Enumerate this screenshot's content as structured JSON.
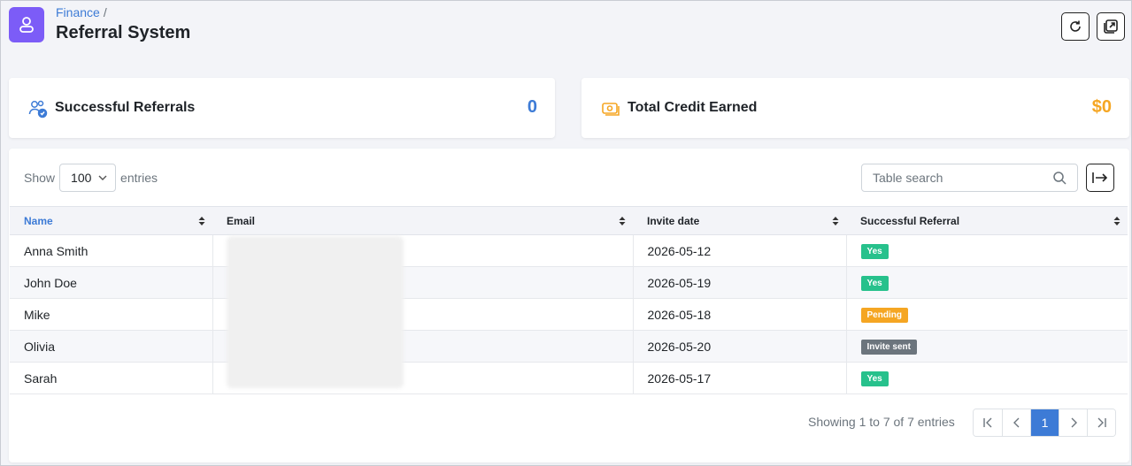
{
  "header": {
    "breadcrumb": "Finance",
    "breadcrumb_sep": "/",
    "title": "Referral System",
    "app_icon": "user-icon",
    "refresh_icon": "refresh-icon",
    "popout_icon": "external-window-icon"
  },
  "cards": {
    "referrals": {
      "label": "Successful Referrals",
      "value": "0",
      "icon": "users-check-icon",
      "color": "#3d7bd6"
    },
    "credit": {
      "label": "Total Credit Earned",
      "value": "$0",
      "icon": "money-icon",
      "color": "#f5a623"
    }
  },
  "table_controls": {
    "show_label": "Show",
    "page_size": "100",
    "entries_label": "entries",
    "search_placeholder": "Table search"
  },
  "table": {
    "columns": [
      "Name",
      "Email",
      "Invite date",
      "Successful Referral"
    ],
    "rows": [
      {
        "name": "Anna Smith",
        "date": "2026-05-12",
        "status": "Yes"
      },
      {
        "name": "John Doe",
        "date": "2026-05-19",
        "status": "Yes"
      },
      {
        "name": "Mike",
        "date": "2026-05-18",
        "status": "Pending"
      },
      {
        "name": "Olivia",
        "date": "2026-05-20",
        "status": "Invite sent"
      },
      {
        "name": "Sarah",
        "date": "2026-05-17",
        "status": "Yes"
      }
    ]
  },
  "status_colors": {
    "Yes": "#27c18c",
    "Pending": "#f5a623",
    "Invite sent": "#6c757d"
  },
  "footer": {
    "info": "Showing 1 to 7 of 7 entries",
    "current_page": "1"
  }
}
